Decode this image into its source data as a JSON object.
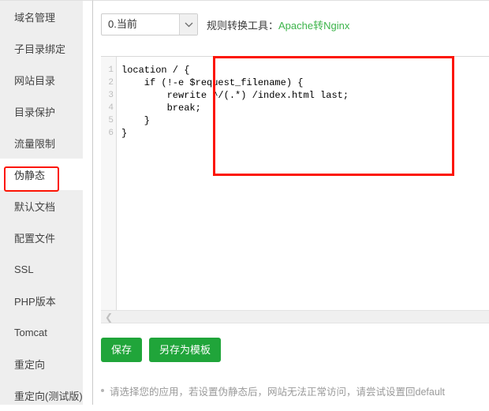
{
  "sidebar": {
    "items": [
      {
        "label": "域名管理",
        "active": false
      },
      {
        "label": "子目录绑定",
        "active": false
      },
      {
        "label": "网站目录",
        "active": false
      },
      {
        "label": "目录保护",
        "active": false
      },
      {
        "label": "流量限制",
        "active": false
      },
      {
        "label": "伪静态",
        "active": true
      },
      {
        "label": "默认文档",
        "active": false
      },
      {
        "label": "配置文件",
        "active": false
      },
      {
        "label": "SSL",
        "active": false
      },
      {
        "label": "PHP版本",
        "active": false
      },
      {
        "label": "Tomcat",
        "active": false
      },
      {
        "label": "重定向",
        "active": false
      },
      {
        "label": "重定向(测试版)",
        "active": false
      }
    ]
  },
  "toolbar": {
    "select_value": "0.当前",
    "select_options": [
      "0.当前"
    ],
    "select_arrow_icon": "chevron-down-icon",
    "tool_label": "规则转换工具：",
    "tool_link": "Apache转Nginx"
  },
  "editor": {
    "line_numbers": [
      "1",
      "2",
      "3",
      "4",
      "5",
      "6"
    ],
    "code": "location / {\n    if (!-e $request_filename) {\n        rewrite ^/(.*) /index.html last;\n        break;\n    }\n}",
    "scroll_left_icon": "chevron-left-icon"
  },
  "buttons": {
    "save": "保存",
    "save_as_template": "另存为模板"
  },
  "footer": {
    "hint": "请选择您的应用，若设置伪静态后，网站无法正常访问，请尝试设置回default"
  },
  "colors": {
    "accent_green": "#20a53a",
    "link_green": "#3cb44a",
    "annotation_red": "#fc1505",
    "sidebar_bg": "#eeeeee"
  }
}
